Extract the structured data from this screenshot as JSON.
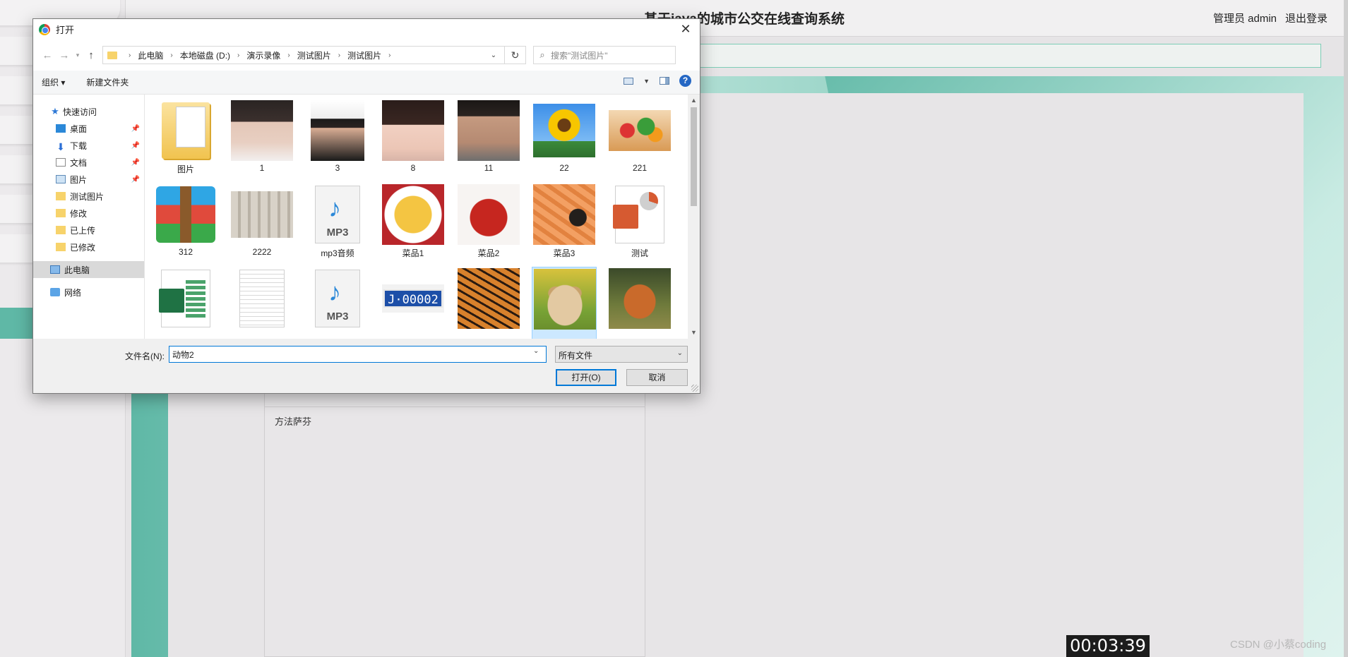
{
  "background_app": {
    "title": "基于java的城市公交在线查询系统",
    "user_label": "管理员 admin",
    "logout_label": "退出登录",
    "editor_text": "方法萨芬",
    "timer": "00:03:39",
    "watermark": "CSDN @小蔡coding",
    "colors": {
      "teal": "#5fb8a6",
      "page_bg": "#e6e4e6"
    }
  },
  "dialog": {
    "title": "打开",
    "address": {
      "crumbs": [
        "此电脑",
        "本地磁盘 (D:)",
        "演示录像",
        "测试图片",
        "测试图片"
      ]
    },
    "search_placeholder": "搜索\"测试图片\"",
    "toolbar": {
      "organize_label": "组织 ▾",
      "new_folder_label": "新建文件夹",
      "help_label": "?"
    },
    "nav_pane": {
      "items": [
        {
          "label": "快速访问",
          "icon": "star-icon"
        },
        {
          "label": "桌面",
          "icon": "desktop-icon",
          "pinned": true
        },
        {
          "label": "下载",
          "icon": "download-icon",
          "pinned": true
        },
        {
          "label": "文档",
          "icon": "document-icon",
          "pinned": true
        },
        {
          "label": "图片",
          "icon": "pictures-icon",
          "pinned": true
        },
        {
          "label": "测试图片",
          "icon": "folder-icon"
        },
        {
          "label": "修改",
          "icon": "folder-icon"
        },
        {
          "label": "已上传",
          "icon": "folder-icon"
        },
        {
          "label": "已修改",
          "icon": "folder-icon"
        },
        {
          "label": "此电脑",
          "icon": "this-pc-icon",
          "selected": true
        },
        {
          "label": "网络",
          "icon": "network-icon"
        }
      ]
    },
    "files": [
      {
        "label": "图片",
        "kind": "folder"
      },
      {
        "label": "1",
        "kind": "photo-portrait"
      },
      {
        "label": "3",
        "kind": "photo-portrait"
      },
      {
        "label": "8",
        "kind": "photo-portrait"
      },
      {
        "label": "11",
        "kind": "photo-portrait"
      },
      {
        "label": "22",
        "kind": "photo-sunflower"
      },
      {
        "label": "221",
        "kind": "photo-food"
      },
      {
        "label": "312",
        "kind": "archive"
      },
      {
        "label": "2222",
        "kind": "photo-bottles"
      },
      {
        "label": "mp3音频",
        "kind": "mp3"
      },
      {
        "label": "菜品1",
        "kind": "photo-dish"
      },
      {
        "label": "菜品2",
        "kind": "photo-dish"
      },
      {
        "label": "菜品3",
        "kind": "photo-dish"
      },
      {
        "label": "测试",
        "kind": "powerpoint"
      },
      {
        "label": "",
        "kind": "excel"
      },
      {
        "label": "",
        "kind": "text"
      },
      {
        "label": "",
        "kind": "mp3"
      },
      {
        "label": "",
        "kind": "photo-plate",
        "plate_text": "J·00002"
      },
      {
        "label": "",
        "kind": "photo-tiger"
      },
      {
        "label": "",
        "kind": "photo-rabbit",
        "selected": true
      },
      {
        "label": "",
        "kind": "photo-fox"
      }
    ],
    "mp3_badge": "MP3",
    "filename_label": "文件名(N):",
    "filename_value": "动物2",
    "filetype_value": "所有文件",
    "open_button": "打开(O)",
    "cancel_button": "取消"
  }
}
